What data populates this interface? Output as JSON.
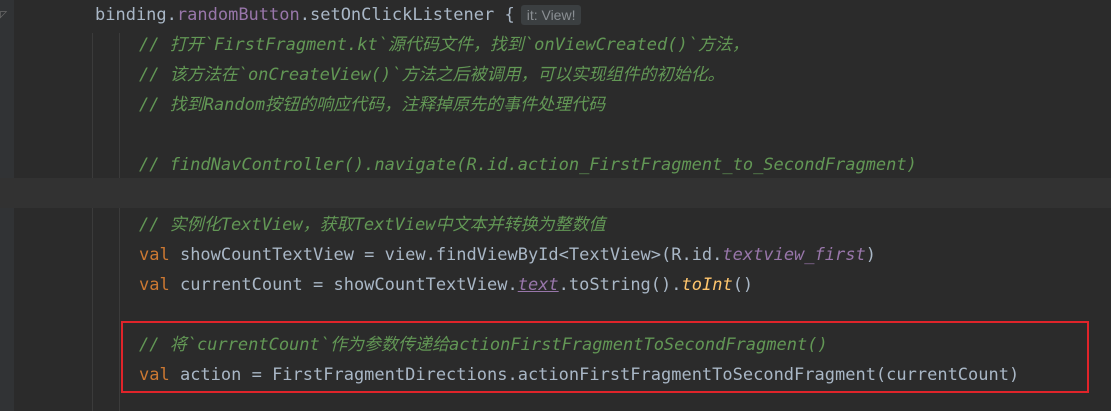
{
  "editor": {
    "line1": {
      "obj": "binding",
      "dot1": ".",
      "prop": "randomButton",
      "dot2": ".",
      "method": "setOnClickListener",
      "brace": " {",
      "hint": "it: View!"
    },
    "line2": "// 打开`FirstFragment.kt`源代码文件，找到`onViewCreated()`方法，",
    "line3": "// 该方法在`onCreateView()`方法之后被调用，可以实现组件的初始化。",
    "line4": "// 找到Random按钮的响应代码，注释掉原先的事件处理代码",
    "line5": "// findNavController().navigate(R.id.action_FirstFragment_to_SecondFragment)",
    "line6": "// 实例化TextView，获取TextView中文本并转换为整数值",
    "line7": {
      "kw": "val",
      "rest1": " showCountTextView = view.findViewById<TextView>(R.id.",
      "prop": "textview_first",
      "rest2": ")"
    },
    "line8": {
      "kw": "val",
      "rest1": " currentCount = showCountTextView.",
      "prop": "text",
      "rest2": ".toString().",
      "fn": "toInt",
      "rest3": "()"
    },
    "line9": "// 将`currentCount`作为参数传递给actionFirstFragmentToSecondFragment()",
    "line10": {
      "kw": "val",
      "rest": " action = FirstFragmentDirections.actionFirstFragmentToSecondFragment(currentCount)"
    }
  },
  "colors": {
    "background": "#2b2b2b",
    "comment": "#629755",
    "keyword": "#cc7832",
    "property": "#9876aa",
    "function": "#ffc66d",
    "highlight_border": "#e0242a"
  }
}
